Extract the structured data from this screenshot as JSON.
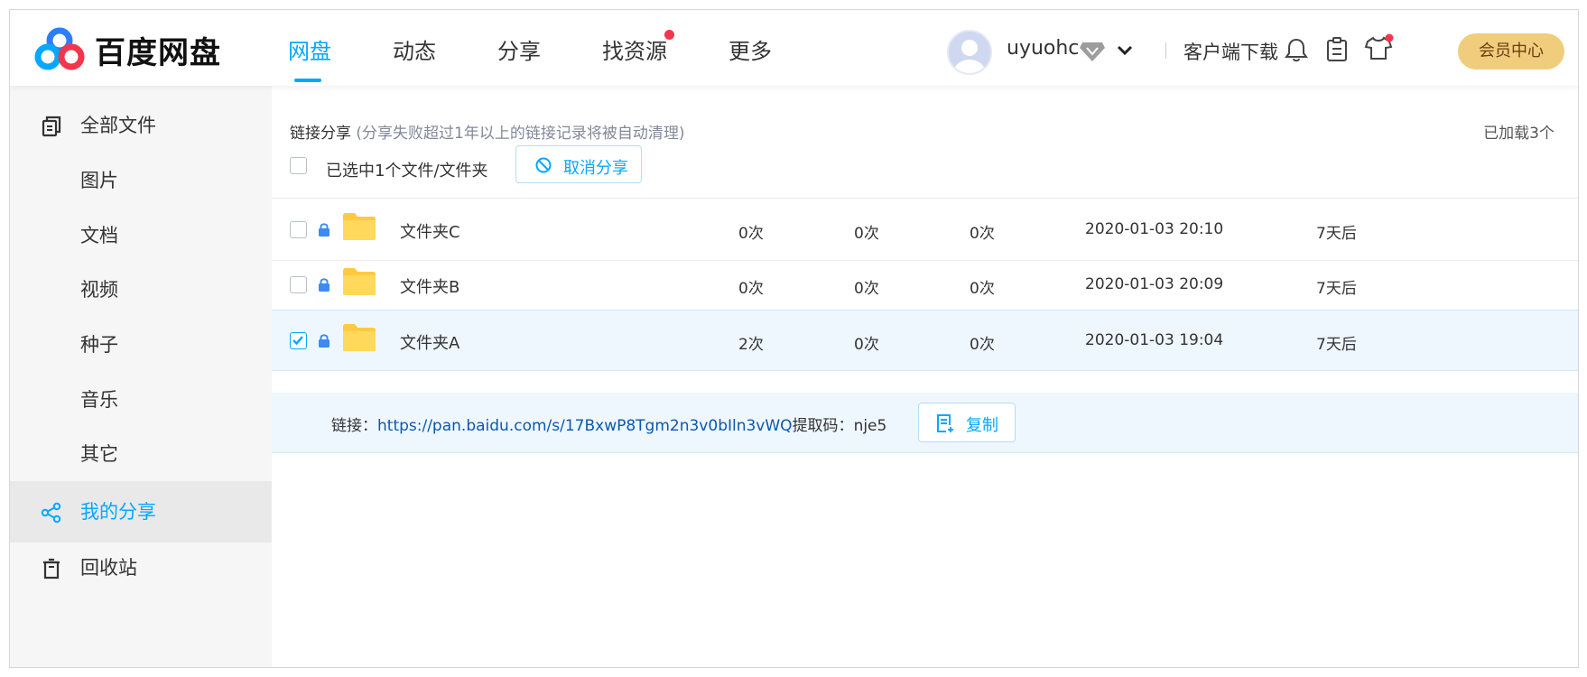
{
  "app": {
    "logo_text": "百度网盘",
    "accent_color": "#06a7ff"
  },
  "header": {
    "nav": [
      {
        "label": "网盘",
        "active": true
      },
      {
        "label": "动态",
        "active": false
      },
      {
        "label": "分享",
        "active": false
      },
      {
        "label": "找资源",
        "active": false,
        "badge_dot": true
      },
      {
        "label": "更多",
        "active": false
      }
    ],
    "username": "uyuohc",
    "client_download": "客户端下载",
    "vip_center": "会员中心",
    "icons": [
      "bell-icon",
      "clipboard-icon",
      "tshirt-icon"
    ]
  },
  "sidebar": {
    "items": [
      {
        "label": "全部文件",
        "icon": "files-icon",
        "active": false
      },
      {
        "label": "图片",
        "active": false
      },
      {
        "label": "文档",
        "active": false
      },
      {
        "label": "视频",
        "active": false
      },
      {
        "label": "种子",
        "active": false
      },
      {
        "label": "音乐",
        "active": false
      },
      {
        "label": "其它",
        "active": false
      },
      {
        "label": "我的分享",
        "icon": "share-icon",
        "active": true
      },
      {
        "label": "回收站",
        "icon": "trash-icon",
        "active": false
      }
    ]
  },
  "main": {
    "title": "链接分享",
    "note": "(分享失败超过1年以上的链接记录将被自动清理)",
    "loaded_count": "已加载3个",
    "selection_text": "已选中1个文件/文件夹",
    "cancel_share": "取消分享",
    "rows": [
      {
        "name": "文件夹C",
        "col1": "0次",
        "col2": "0次",
        "col3": "0次",
        "time": "2020-01-03 20:10",
        "expire": "7天后",
        "checked": false
      },
      {
        "name": "文件夹B",
        "col1": "0次",
        "col2": "0次",
        "col3": "0次",
        "time": "2020-01-03 20:09",
        "expire": "7天后",
        "checked": false
      },
      {
        "name": "文件夹A",
        "col1": "2次",
        "col2": "0次",
        "col3": "0次",
        "time": "2020-01-03 19:04",
        "expire": "7天后",
        "checked": true
      }
    ],
    "link": {
      "label": "链接：",
      "url": "https://pan.baidu.com/s/17BxwP8Tgm2n3v0bIln3vWQ",
      "code_label": "提取码：",
      "code": "nje5",
      "copy": "复制"
    }
  }
}
